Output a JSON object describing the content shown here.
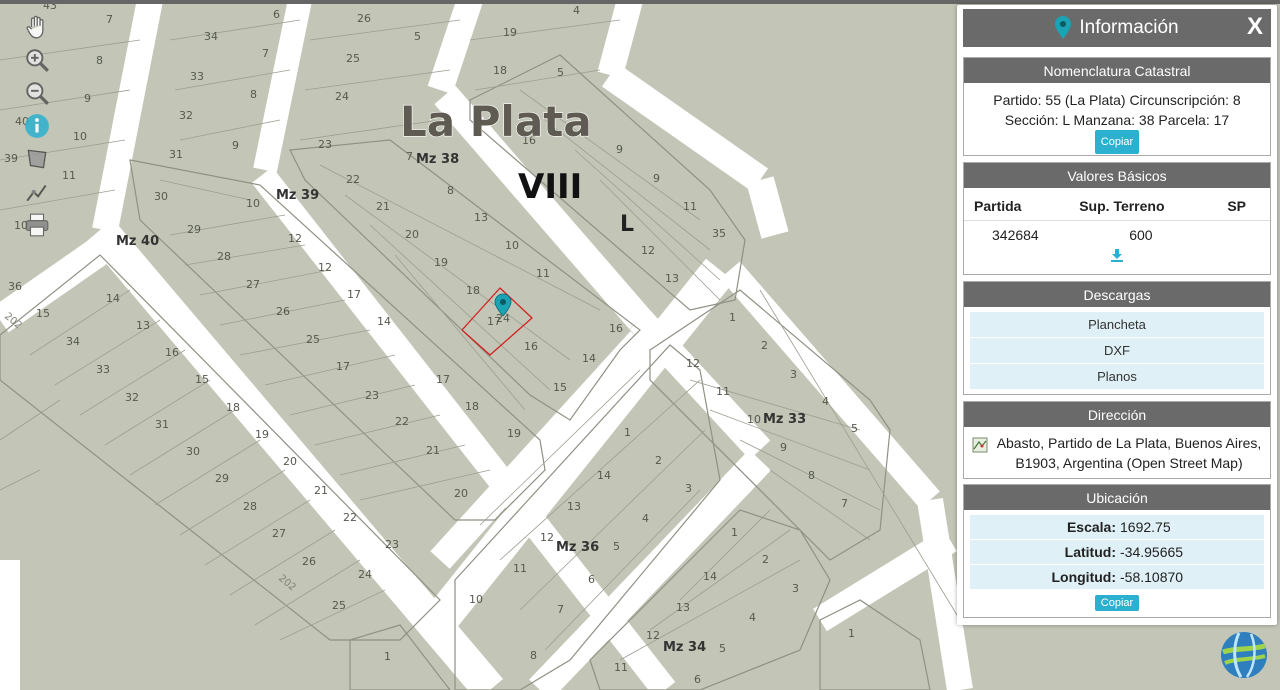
{
  "map": {
    "city_label": "La Plata",
    "circ_label": "VIII",
    "section_label": "L",
    "manzanas": [
      "Mz 38",
      "Mz 39",
      "Mz 40",
      "Mz 33",
      "Mz 36",
      "Mz 34"
    ],
    "street_labels": [
      "202",
      "202"
    ],
    "parcels": [
      {
        "t": "43"
      },
      {
        "t": "7"
      },
      {
        "t": "6"
      },
      {
        "t": "26"
      },
      {
        "t": "5"
      },
      {
        "t": "4"
      },
      {
        "t": "34"
      },
      {
        "t": "7"
      },
      {
        "t": "8"
      },
      {
        "t": "33"
      },
      {
        "t": "8"
      },
      {
        "t": "25"
      },
      {
        "t": "19"
      },
      {
        "t": "18"
      },
      {
        "t": "5"
      },
      {
        "t": "9"
      },
      {
        "t": "24"
      },
      {
        "t": "32"
      },
      {
        "t": "40"
      },
      {
        "t": "10"
      },
      {
        "t": "23"
      },
      {
        "t": "16"
      },
      {
        "t": "9"
      },
      {
        "t": "31"
      },
      {
        "t": "39"
      },
      {
        "t": "11"
      },
      {
        "t": "22"
      },
      {
        "t": "7"
      },
      {
        "t": "8"
      },
      {
        "t": "30"
      },
      {
        "t": "10"
      },
      {
        "t": "21"
      },
      {
        "t": "9"
      },
      {
        "t": "13"
      },
      {
        "t": "9"
      },
      {
        "t": "29"
      },
      {
        "t": "20"
      },
      {
        "t": "10"
      },
      {
        "t": "10"
      },
      {
        "t": "12"
      },
      {
        "t": "11"
      },
      {
        "t": "28"
      },
      {
        "t": "19"
      },
      {
        "t": "11"
      },
      {
        "t": "12"
      },
      {
        "t": "36"
      },
      {
        "t": "14"
      },
      {
        "t": "27"
      },
      {
        "t": "18"
      },
      {
        "t": "12"
      },
      {
        "t": "35"
      },
      {
        "t": "15"
      },
      {
        "t": "13"
      },
      {
        "t": "26"
      },
      {
        "t": "17"
      },
      {
        "t": "13"
      },
      {
        "t": "1"
      },
      {
        "t": "34"
      },
      {
        "t": "16"
      },
      {
        "t": "25"
      },
      {
        "t": "14"
      },
      {
        "t": "16"
      },
      {
        "t": "2"
      },
      {
        "t": "12"
      },
      {
        "t": "33"
      },
      {
        "t": "15"
      },
      {
        "t": "17"
      },
      {
        "t": "24"
      },
      {
        "t": "16"
      },
      {
        "t": "14"
      },
      {
        "t": "3"
      },
      {
        "t": "11"
      },
      {
        "t": "32"
      },
      {
        "t": "18"
      },
      {
        "t": "23"
      },
      {
        "t": "17"
      },
      {
        "t": "15"
      },
      {
        "t": "4"
      },
      {
        "t": "10"
      },
      {
        "t": "31"
      },
      {
        "t": "19"
      },
      {
        "t": "22"
      },
      {
        "t": "18"
      },
      {
        "t": "5"
      },
      {
        "t": "9"
      },
      {
        "t": "30"
      },
      {
        "t": "20"
      },
      {
        "t": "21"
      },
      {
        "t": "19"
      },
      {
        "t": "8"
      },
      {
        "t": "29"
      },
      {
        "t": "21"
      },
      {
        "t": "20"
      },
      {
        "t": "1"
      },
      {
        "t": "2"
      },
      {
        "t": "14"
      },
      {
        "t": "3"
      },
      {
        "t": "13"
      },
      {
        "t": "7"
      },
      {
        "t": "28"
      },
      {
        "t": "22"
      },
      {
        "t": "4"
      },
      {
        "t": "12"
      },
      {
        "t": "5"
      },
      {
        "t": "27"
      },
      {
        "t": "23"
      },
      {
        "t": "1"
      },
      {
        "t": "2"
      },
      {
        "t": "11"
      },
      {
        "t": "6"
      },
      {
        "t": "26"
      },
      {
        "t": "24"
      },
      {
        "t": "14"
      },
      {
        "t": "3"
      },
      {
        "t": "10"
      },
      {
        "t": "7"
      },
      {
        "t": "25"
      },
      {
        "t": "13"
      },
      {
        "t": "4"
      },
      {
        "t": "12"
      },
      {
        "t": "1"
      },
      {
        "t": "8"
      },
      {
        "t": "11"
      },
      {
        "t": "5"
      },
      {
        "t": "6"
      },
      {
        "t": "1"
      }
    ],
    "selected_parcel": "17"
  },
  "toolbar": {
    "tools": [
      "hand-icon",
      "zoom-in-icon",
      "zoom-out-icon",
      "info-icon",
      "measure-icon",
      "draw-icon",
      "print-icon"
    ]
  },
  "panel": {
    "title": "Información",
    "close_label": "X",
    "nomenclatura": {
      "title": "Nomenclatura Catastral",
      "line1": "Partido: 55 (La Plata) Circunscripción: 8",
      "line2": "Sección: L Manzana: 38 Parcela: 17",
      "copy_label": "Copiar"
    },
    "valores": {
      "title": "Valores Básicos",
      "headers": [
        "Partida",
        "Sup. Terreno",
        "SP"
      ],
      "row": [
        "342684",
        "600",
        ""
      ]
    },
    "descargas": {
      "title": "Descargas",
      "items": [
        "Plancheta",
        "DXF",
        "Planos"
      ]
    },
    "direccion": {
      "title": "Dirección",
      "line1": "Abasto, Partido de La Plata, Buenos Aires,",
      "line2": "B1903, Argentina (Open Street Map)"
    },
    "ubicacion": {
      "title": "Ubicación",
      "escala_label": "Escala:",
      "escala": "1692.75",
      "latitud_label": "Latitud:",
      "latitud": "-34.95665",
      "longitud_label": "Longitud:",
      "longitud": "-58.10870",
      "copy_label": "Copiar"
    }
  },
  "colors": {
    "map_bg": "#c3c6b7",
    "block_fill": "#c8cbbd",
    "road": "#ffffff",
    "panel_header": "#6a6a6a",
    "accent": "#2bb1cf",
    "selected": "#d22020"
  }
}
